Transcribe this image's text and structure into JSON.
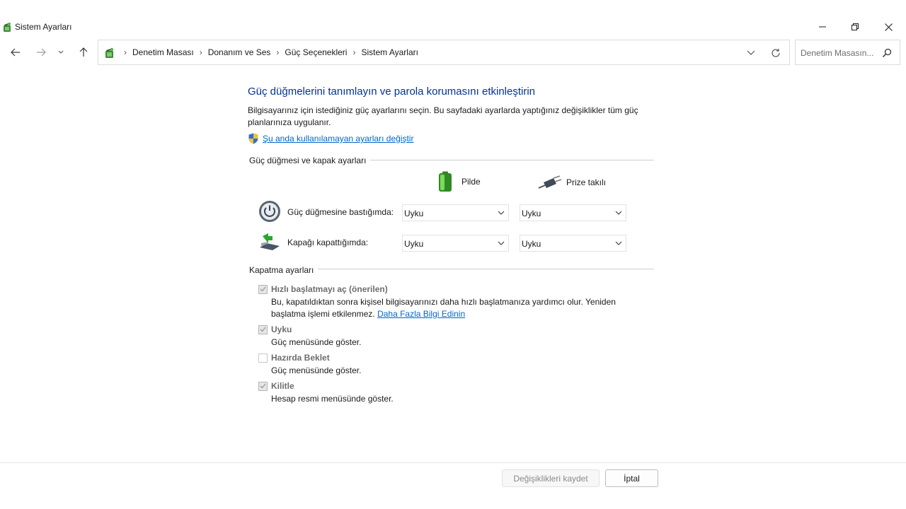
{
  "window": {
    "title": "Sistem Ayarları",
    "icon": "control-panel-power-icon"
  },
  "address": {
    "breadcrumbs": [
      "Denetim Masası",
      "Donanım ve Ses",
      "Güç Seçenekleri",
      "Sistem Ayarları"
    ]
  },
  "search": {
    "placeholder": "Denetim Masasın..."
  },
  "page": {
    "title": "Güç düğmelerini tanımlayın ve parola korumasını etkinleştirin",
    "description": "Bilgisayarınız için istediğiniz güç ayarlarını seçin. Bu sayfadaki ayarlarda yaptığınız değişiklikler tüm güç planlarınıza uygulanır.",
    "change_link": "Şu anda kullanılamayan ayarları değiştir"
  },
  "power_settings": {
    "header": "Güç düğmesi ve kapak ayarları",
    "col_battery": "Pilde",
    "col_plugged": "Prize takılı",
    "rows": [
      {
        "label": "Güç düğmesine bastığımda:",
        "battery": "Uyku",
        "plugged": "Uyku"
      },
      {
        "label": "Kapağı kapattığımda:",
        "battery": "Uyku",
        "plugged": "Uyku"
      }
    ]
  },
  "shutdown_settings": {
    "header": "Kapatma ayarları",
    "items": [
      {
        "label": "Hızlı başlatmayı aç (önerilen)",
        "checked": true,
        "desc": "Bu, kapatıldıktan sonra kişisel bilgisayarınızı daha hızlı başlatmanıza yardımcı olur. Yeniden başlatma işlemi etkilenmez.",
        "link": "Daha Fazla Bilgi Edinin"
      },
      {
        "label": "Uyku",
        "checked": true,
        "desc": "Güç menüsünde göster."
      },
      {
        "label": "Hazırda Beklet",
        "checked": false,
        "desc": "Güç menüsünde göster."
      },
      {
        "label": "Kilitle",
        "checked": true,
        "desc": "Hesap resmi menüsünde göster."
      }
    ]
  },
  "footer": {
    "save_label": "Değişiklikleri kaydet",
    "cancel_label": "İptal"
  },
  "colors": {
    "title_blue": "#003399",
    "link_blue": "#0066cc"
  }
}
